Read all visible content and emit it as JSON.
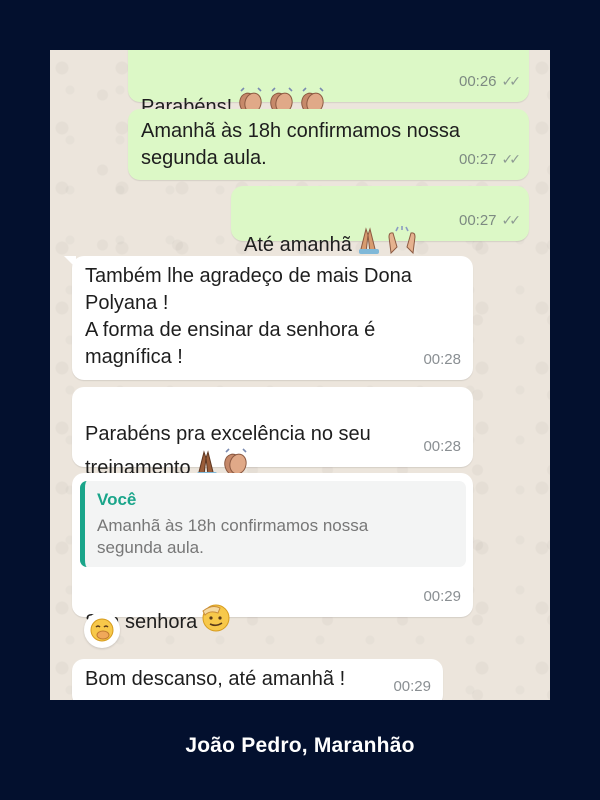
{
  "messages": [
    {
      "text": "Parabéns!",
      "time": "00:26",
      "ticks": "✓✓"
    },
    {
      "text": "Amanhã às 18h confirmamos nossa\nsegunda aula.",
      "time": "00:27",
      "ticks": "✓✓"
    },
    {
      "text": "Até amanhã",
      "time": "00:27",
      "ticks": "✓✓"
    },
    {
      "text": "Também lhe agradeço de mais Dona\nPolyana !\nA forma de ensinar da senhora é\nmagnífica !",
      "time": "00:28"
    },
    {
      "text": "Parabéns pra excelência no seu\ntreinamento",
      "time": "00:28"
    },
    {
      "quote_author": "Você",
      "quote_text": "Amanhã às 18h confirmamos nossa\nsegunda aula.",
      "text": "Sim senhora",
      "time": "00:29"
    },
    {
      "text": "Bom descanso, até amanhã !",
      "time": "00:29"
    }
  ],
  "caption": "João Pedro, Maranhão",
  "colors": {
    "page_background": "#03102e",
    "chat_background": "#ece5dc",
    "outgoing_bubble": "#dcf8c6",
    "incoming_bubble": "#ffffff",
    "quote_accent": "#1aa58a"
  }
}
